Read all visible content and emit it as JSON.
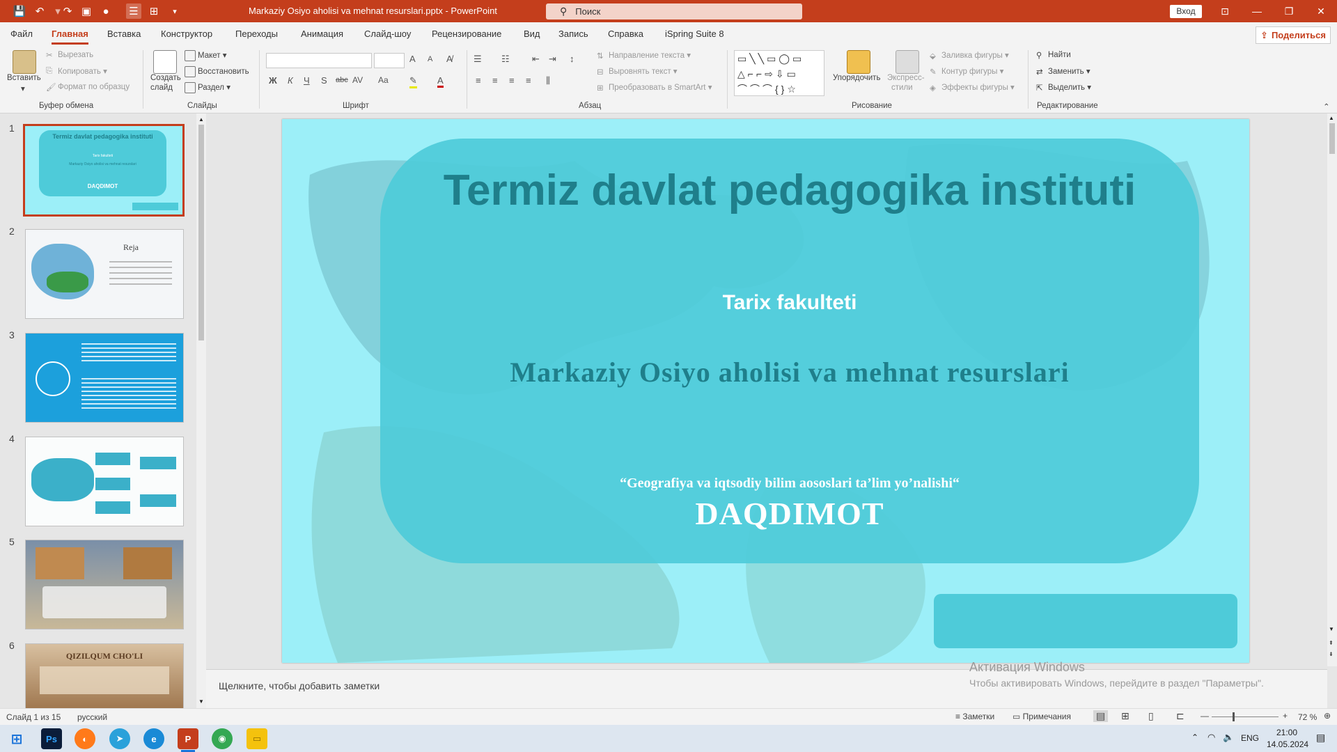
{
  "titlebar": {
    "document_title": "Markaziy Osiyo aholisi va mehnat resurslari.pptx  -  PowerPoint",
    "search_placeholder": "Поиск",
    "signin": "Вход"
  },
  "menu": {
    "tabs": [
      "Файл",
      "Главная",
      "Вставка",
      "Конструктор",
      "Переходы",
      "Анимация",
      "Слайд-шоу",
      "Рецензирование",
      "Вид",
      "Запись",
      "Справка",
      "iSpring Suite 8"
    ],
    "active_tab": "Главная",
    "share": "Поделиться"
  },
  "ribbon": {
    "clipboard": {
      "paste": "Вставить",
      "cut": "Вырезать",
      "copy": "Копировать",
      "format_painter": "Формат по образцу",
      "group": "Буфер обмена"
    },
    "slides": {
      "new_slide": "Создать",
      "new_slide2": "слайд",
      "layout": "Макет",
      "reset": "Восстановить",
      "section": "Раздел",
      "group": "Слайды"
    },
    "font": {
      "group": "Шрифт",
      "bold": "Ж",
      "italic": "К",
      "underline": "Ч",
      "strike": "S",
      "strike2": "abc",
      "spacing": "AV",
      "case": "Aa",
      "grow": "A",
      "shrink": "A"
    },
    "paragraph": {
      "text_direction": "Направление текста",
      "align_text": "Выровнять текст",
      "smartart": "Преобразовать в SmartArt",
      "group": "Абзац"
    },
    "drawing": {
      "arrange": "Упорядочить",
      "quick_styles": "Экспресс-",
      "quick_styles2": "стили",
      "fill": "Заливка фигуры",
      "outline": "Контур фигуры",
      "effects": "Эффекты фигуры",
      "group": "Рисование"
    },
    "editing": {
      "find": "Найти",
      "replace": "Заменить",
      "select": "Выделить",
      "group": "Редактирование"
    }
  },
  "slides_panel": {
    "numbers": [
      "1",
      "2",
      "3",
      "4",
      "5",
      "6"
    ],
    "thumb1": {
      "title": "Termiz davlat pedagogika instituti",
      "sub": "Tarix fakulteti",
      "topic": "Markaziy Osiyo aholisi va mehnat resurslari",
      "present": "DAQDIMOT"
    },
    "thumb2_title": "Reja",
    "thumb6_title": "QIZILQUM CHO'LI"
  },
  "slide": {
    "institute": "Termiz davlat pedagogika instituti",
    "faculty": "Tarix fakulteti",
    "topic": "Markaziy Osiyo aholisi va mehnat resurslari",
    "direction": "“Geografiya va iqtsodiy bilim aososlari  ta’lim yo’nalishi“",
    "presentation": "DAQDIMOT"
  },
  "notes_placeholder": "Щелкните, чтобы добавить заметки",
  "watermark": {
    "line1": "Активация Windows",
    "line2": "Чтобы активировать Windows, перейдите в раздел \"Параметры\"."
  },
  "status": {
    "slide_info": "Слайд 1 из 15",
    "language": "русский",
    "notes": "Заметки",
    "comments": "Примечания",
    "zoom": "72 %"
  },
  "taskbar": {
    "lang": "ENG",
    "time": "21:00",
    "date": "14.05.2024"
  },
  "colors": {
    "accent": "#c43e1c",
    "slide_bg": "#9ceff8",
    "panel": "#4ecbd9",
    "title_text": "#1f7f8b"
  }
}
